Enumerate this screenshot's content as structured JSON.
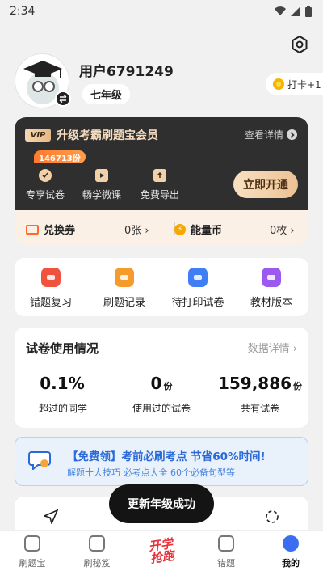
{
  "status": {
    "time": "2:34"
  },
  "profile": {
    "username": "用户6791249",
    "grade": "七年级",
    "checkin_label": "打卡+1"
  },
  "vip": {
    "tag": "VIP",
    "title": "升级考霸刷题宝会员",
    "details_label": "查看详情",
    "count_badge": "146713份",
    "perks": [
      {
        "label": "专享试卷",
        "icon": "exam-icon"
      },
      {
        "label": "畅学微课",
        "icon": "video-icon"
      },
      {
        "label": "免费导出",
        "icon": "export-icon"
      }
    ],
    "open_button": "立即开通",
    "coupon": {
      "label": "兑换券",
      "value": "0张"
    },
    "coins": {
      "label": "能量币",
      "value": "0枚"
    }
  },
  "tools": [
    {
      "label": "错题复习",
      "color": "#f0533d"
    },
    {
      "label": "刷题记录",
      "color": "#f59a2b"
    },
    {
      "label": "待打印试卷",
      "color": "#3f7ef5"
    },
    {
      "label": "教材版本",
      "color": "#9b59f0"
    }
  ],
  "usage": {
    "title": "试卷使用情况",
    "link": "数据详情",
    "stats": [
      {
        "value": "0.1%",
        "unit": "",
        "label": "超过的同学"
      },
      {
        "value": "0",
        "unit": "份",
        "label": "使用过的试卷"
      },
      {
        "value": "159,886",
        "unit": "份",
        "label": "共有试卷"
      }
    ]
  },
  "promo": {
    "title": "【免费领】考前必刷考点 节省60%时间!",
    "subtitle": "解题十大技巧 必考点大全 60个必备句型等"
  },
  "toast": "更新年级成功",
  "tabbar": {
    "items": [
      {
        "label": "刷题宝"
      },
      {
        "label": "刷秘笈"
      },
      {
        "label": "错题"
      },
      {
        "label": "我的"
      }
    ],
    "center_logo_line1": "开学",
    "center_logo_line2": "抢跑"
  },
  "colors": {
    "accent_blue": "#3a6df0",
    "vip_dark": "#2f2f2f",
    "vip_gold": "#f5dcc0"
  }
}
